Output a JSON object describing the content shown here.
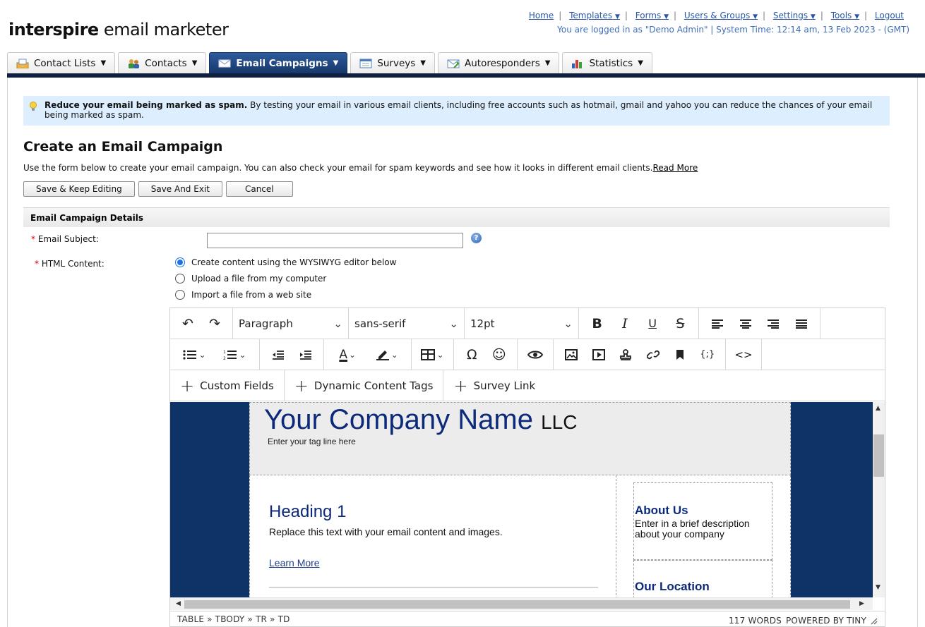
{
  "app": {
    "logo_bold": "interspire",
    "logo_rest": " email marketer"
  },
  "topnav": {
    "home": "Home",
    "templates": "Templates",
    "forms": "Forms",
    "users_groups": "Users & Groups",
    "settings": "Settings",
    "tools": "Tools",
    "logout": "Logout",
    "login_status": "You are logged in as \"Demo Admin\" | System Time: 12:14 am, 13 Feb 2023 - (GMT)"
  },
  "tabs": [
    {
      "label": "Contact Lists"
    },
    {
      "label": "Contacts"
    },
    {
      "label": "Email Campaigns",
      "active": true
    },
    {
      "label": "Surveys"
    },
    {
      "label": "Autoresponders"
    },
    {
      "label": "Statistics"
    }
  ],
  "tip": {
    "bold": "Reduce your email being marked as spam.",
    "text": " By testing your email in various email clients, including free accounts such as hotmail, gmail and yahoo you can reduce the chances of your email being marked as spam."
  },
  "page": {
    "title": "Create an Email Campaign",
    "description": "Use the form below to create your email campaign. You can also check your email for spam keywords and see how it looks in different email clients.",
    "read_more": "Read More"
  },
  "buttons": {
    "save_keep": "Save & Keep Editing",
    "save_exit": "Save And Exit",
    "cancel": "Cancel"
  },
  "form": {
    "section_title": "Email Campaign Details",
    "subject_label": "Email Subject:",
    "subject_value": "",
    "html_label": "HTML Content:",
    "options": [
      {
        "label": "Create content using the WYSIWYG editor below",
        "selected": true
      },
      {
        "label": "Upload a file from my computer",
        "selected": false
      },
      {
        "label": "Import a file from a web site",
        "selected": false
      }
    ]
  },
  "editor": {
    "block_format": "Paragraph",
    "font_family": "sans-serif",
    "font_size": "12pt",
    "insert_buttons": {
      "custom_fields": "Custom Fields",
      "dynamic_tags": "Dynamic Content Tags",
      "survey_link": "Survey Link"
    },
    "path": "TABLE » TBODY » TR » TD",
    "word_count": "117 WORDS",
    "powered_by": "POWERED BY TINY"
  },
  "template": {
    "company": "Your Company Name",
    "company_suffix": "LLC",
    "tagline": "Enter your tag line here",
    "heading": "Heading 1",
    "body_text": "Replace this text with your email content and images.",
    "learn_more": "Learn More",
    "about_title": "About Us",
    "about_text": "Enter in a brief description about your company",
    "location_title": "Our Location"
  },
  "colors": {
    "active_tab": "#1f4785",
    "tip_bg": "#ddeeff",
    "link": "#2b57a6",
    "template_navy": "#0e3366",
    "heading_blue": "#0d2a7a"
  }
}
